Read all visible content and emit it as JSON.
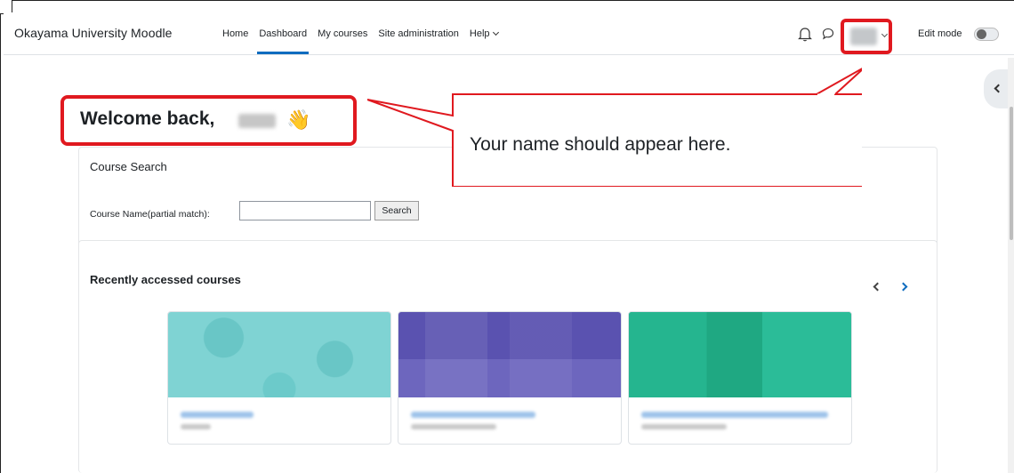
{
  "navbar": {
    "brand": "Okayama University Moodle",
    "links": [
      {
        "label": "Home"
      },
      {
        "label": "Dashboard",
        "active": true
      },
      {
        "label": "My courses"
      },
      {
        "label": "Site administration"
      },
      {
        "label": "Help",
        "dropdown": true
      }
    ],
    "icons": [
      "bell-icon",
      "chat-icon",
      "chevron-down-icon"
    ],
    "edit_mode_label": "Edit mode",
    "edit_mode_on": false
  },
  "welcome": {
    "text": "Welcome back,",
    "emoji": "👋"
  },
  "course_search": {
    "title": "Course Search",
    "label": "Course Name(partial match):",
    "value": "",
    "button": "Search"
  },
  "recent_courses": {
    "title": "Recently accessed courses",
    "count": 3,
    "image_colors": [
      "#7fd3d3",
      "#5a52b0",
      "#23b08a"
    ]
  },
  "annotation": {
    "text": "Your name should appear here.",
    "color": "#e0191f"
  },
  "colors": {
    "accent": "#0f6cbf",
    "highlight": "#e0191f"
  }
}
